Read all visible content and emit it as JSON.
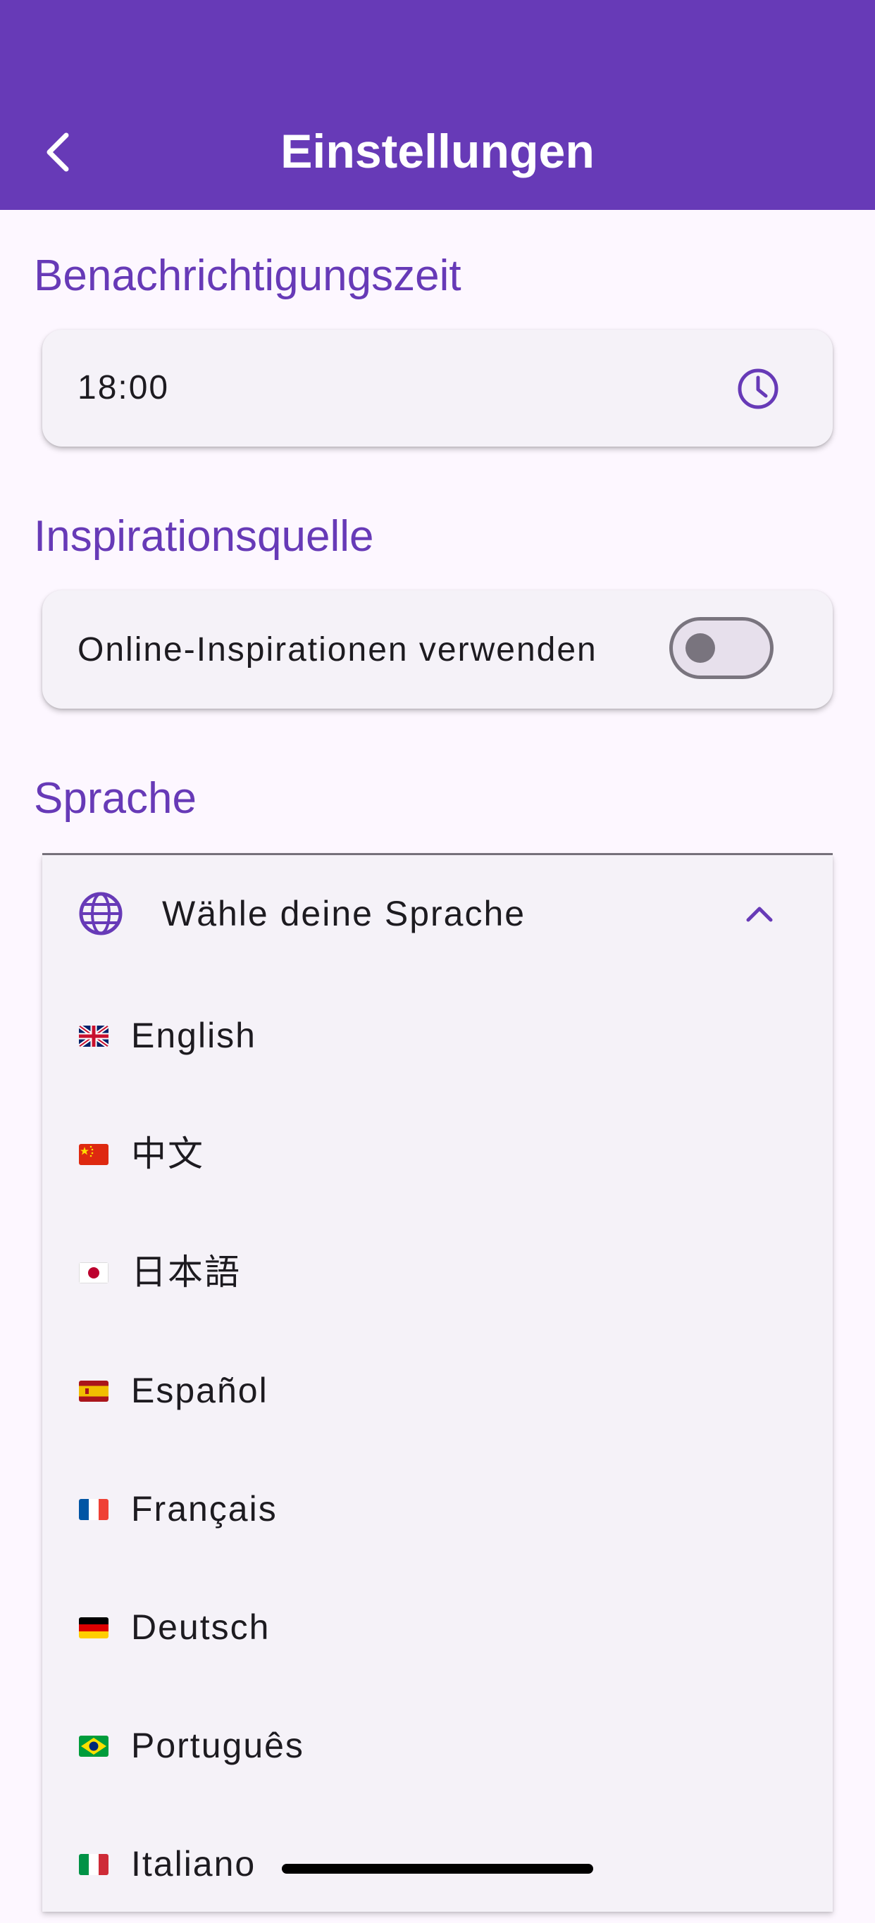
{
  "app": {
    "title": "Einstellungen",
    "accent_color": "#673ab7",
    "back_icon": "chevron-left-icon"
  },
  "notification": {
    "section_title": "Benachrichtigungszeit",
    "time_value": "18:00",
    "icon": "clock-icon"
  },
  "inspiration": {
    "section_title": "Inspirationsquelle",
    "toggle_label": "Online-Inspirationen verwenden",
    "toggle_on": false
  },
  "language": {
    "section_title": "Sprache",
    "dropdown_label": "Wähle deine Sprache",
    "dropdown_icon": "globe-icon",
    "expanded": true,
    "options": [
      {
        "label": "English",
        "flag": "uk-flag-icon"
      },
      {
        "label": "中文",
        "flag": "china-flag-icon"
      },
      {
        "label": "日本語",
        "flag": "japan-flag-icon"
      },
      {
        "label": "Español",
        "flag": "spain-flag-icon"
      },
      {
        "label": "Français",
        "flag": "france-flag-icon"
      },
      {
        "label": "Deutsch",
        "flag": "germany-flag-icon"
      },
      {
        "label": "Português",
        "flag": "brazil-flag-icon"
      },
      {
        "label": "Italiano",
        "flag": "italy-flag-icon"
      }
    ]
  }
}
